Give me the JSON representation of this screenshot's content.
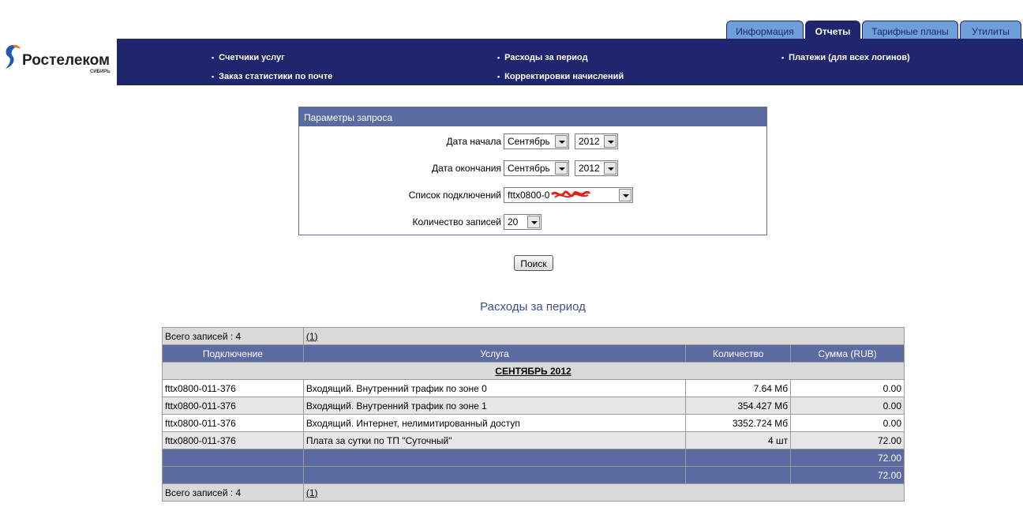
{
  "brand": {
    "name": "Ростелеком",
    "sub": "СИБИРЬ"
  },
  "tabs": [
    {
      "label": "Информация",
      "active": false
    },
    {
      "label": "Отчеты",
      "active": true
    },
    {
      "label": "Тарифные планы",
      "active": false
    },
    {
      "label": "Утилиты",
      "active": false
    }
  ],
  "nav": {
    "counters": "Счетчики услуг",
    "mail_stats": "Заказ статистики по почте",
    "expenses": "Расходы за период",
    "corrections": "Корректировки начислений",
    "payments": "Платежи (для всех логинов)"
  },
  "params": {
    "title": "Параметры запроса",
    "start_label": "Дата начала",
    "start_month": "Сентябрь",
    "start_year": "2012",
    "end_label": "Дата окончания",
    "end_month": "Сентябрь",
    "end_year": "2012",
    "conn_label": "Список подключений",
    "conn_value": "fttx0800-0",
    "count_label": "Количество записей",
    "count_value": "20"
  },
  "search_button": "Поиск",
  "report": {
    "title": "Расходы за период",
    "total_records": "Всего записей : 4",
    "page_link": "(1)",
    "columns": [
      "Подключение",
      "Услуга",
      "Количество",
      "Сумма (RUB)"
    ],
    "month": "СЕНТЯБРЬ 2012",
    "rows": [
      {
        "conn": "fttx0800-011-376",
        "service": "Входящий. Внутренний трафик по зоне 0",
        "qty": "7.64 Мб",
        "sum": "0.00"
      },
      {
        "conn": "fttx0800-011-376",
        "service": "Входящий. Внутренний трафик по зоне 1",
        "qty": "354.427 Мб",
        "sum": "0.00"
      },
      {
        "conn": "fttx0800-011-376",
        "service": "Входящий. Интернет, нелимитированный доступ",
        "qty": "3352.724 Мб",
        "sum": "0.00"
      },
      {
        "conn": "fttx0800-011-376",
        "service": "Плата за сутки по ТП \"Суточный\"",
        "qty": "4 шт",
        "sum": "72.00"
      }
    ],
    "subtotal": "72.00",
    "total": "72.00"
  }
}
